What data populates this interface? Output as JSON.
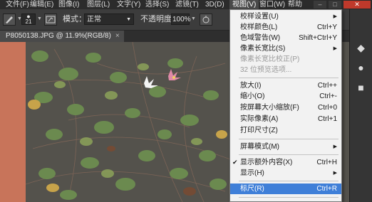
{
  "menubar": {
    "items": [
      "文件(F)",
      "编辑(E)",
      "图像(I)",
      "图层(L)",
      "文字(Y)",
      "选择(S)",
      "滤镜(T)",
      "3D(D)",
      "视图(V)",
      "窗口(W)",
      "帮助"
    ],
    "active": "视图(V)",
    "window_controls": [
      "–",
      "□",
      "✕"
    ]
  },
  "options": {
    "brush_size": "21",
    "mode_label": "模式：",
    "mode_value": "正常",
    "opacity_label": "不透明度：",
    "opacity_value": "100%"
  },
  "document": {
    "tab_title": "P8050138.JPG @ 11.9%(RGB/8)",
    "close": "×"
  },
  "view_menu": {
    "items": [
      {
        "label": "校样设置(U)",
        "shortcut": "",
        "submenu": true
      },
      {
        "label": "校样颜色(L)",
        "shortcut": "Ctrl+Y"
      },
      {
        "label": "色域警告(W)",
        "shortcut": "Shift+Ctrl+Y"
      },
      {
        "label": "像素长宽比(S)",
        "shortcut": "",
        "submenu": true
      },
      {
        "label": "像素长宽比校正(P)",
        "shortcut": "",
        "disabled": true
      },
      {
        "label": "32 位预览选项...",
        "shortcut": "",
        "disabled": true
      },
      {
        "label": "放大(I)",
        "shortcut": "Ctrl++"
      },
      {
        "label": "缩小(O)",
        "shortcut": "Ctrl+-"
      },
      {
        "label": "按屏幕大小缩放(F)",
        "shortcut": "Ctrl+0"
      },
      {
        "label": "实际像素(A)",
        "shortcut": "Ctrl+1"
      },
      {
        "label": "打印尺寸(Z)",
        "shortcut": ""
      },
      {
        "label": "屏幕模式(M)",
        "shortcut": "",
        "submenu": true
      },
      {
        "label": "显示额外内容(X)",
        "shortcut": "Ctrl+H",
        "checked": true
      },
      {
        "label": "显示(H)",
        "shortcut": "",
        "submenu": true
      },
      {
        "label": "标尺(R)",
        "shortcut": "Ctrl+R",
        "highlighted": true
      }
    ]
  },
  "colors": {
    "menu_highlight": "#3f7fd8",
    "ruler": "#c8745a"
  }
}
